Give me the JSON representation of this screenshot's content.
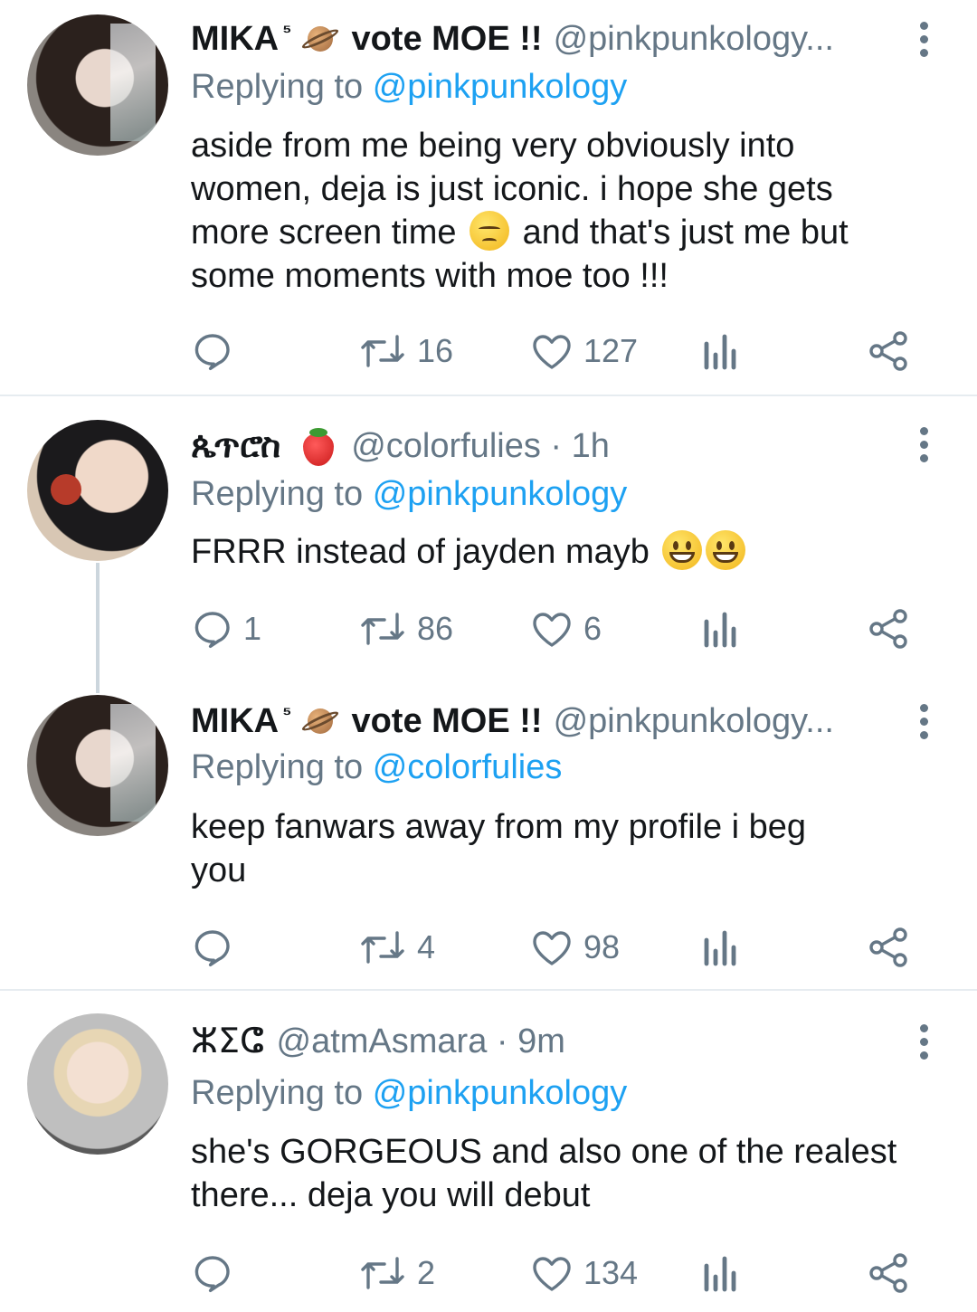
{
  "tweets": [
    {
      "name": "MIKA",
      "name_sup": "⁵",
      "name_suffix": "vote MOE !!",
      "handle": "@pinkpunkology...",
      "replying_prefix": "Replying to",
      "replying_to": "@pinkpunkology",
      "lines": [
        "aside from me being very obviously into",
        "women, deja is just iconic. i hope she gets"
      ],
      "line3_before": "more screen time",
      "line3_after": "and that's just me but",
      "line4": "some moments with moe too !!!",
      "replies": "",
      "retweets": "16",
      "likes": "127"
    },
    {
      "name": "ጴጥሮስ",
      "handle": "@colorfulies · 1h",
      "replying_prefix": "Replying to",
      "replying_to": "@pinkpunkology",
      "text": "FRRR instead of jayden mayb",
      "replies": "1",
      "retweets": "86",
      "likes": "6"
    },
    {
      "name": "MIKA",
      "name_sup": "⁵",
      "name_suffix": "vote MOE !!",
      "handle": "@pinkpunkology...",
      "replying_prefix": "Replying to",
      "replying_to": "@colorfulies",
      "lines": [
        "keep fanwars away from my profile i beg",
        "you"
      ],
      "replies": "",
      "retweets": "4",
      "likes": "98"
    },
    {
      "name": "ⵣⵉⵛ",
      "handle": "@atmAsmara · 9m",
      "replying_prefix": "Replying to",
      "replying_to": "@pinkpunkology",
      "lines": [
        "she's GORGEOUS and also one of the realest",
        "there... deja you will debut"
      ],
      "replies": "",
      "retweets": "2",
      "likes": "134"
    }
  ],
  "icons": {
    "reply": "reply-icon",
    "retweet": "retweet-icon",
    "like": "heart-icon",
    "analytics": "analytics-icon",
    "share": "share-icon",
    "more": "more-vertical-icon"
  },
  "colors": {
    "text": "#14171a",
    "secondary": "#657786",
    "link": "#1da1f2",
    "divider": "#e6ecf0"
  }
}
